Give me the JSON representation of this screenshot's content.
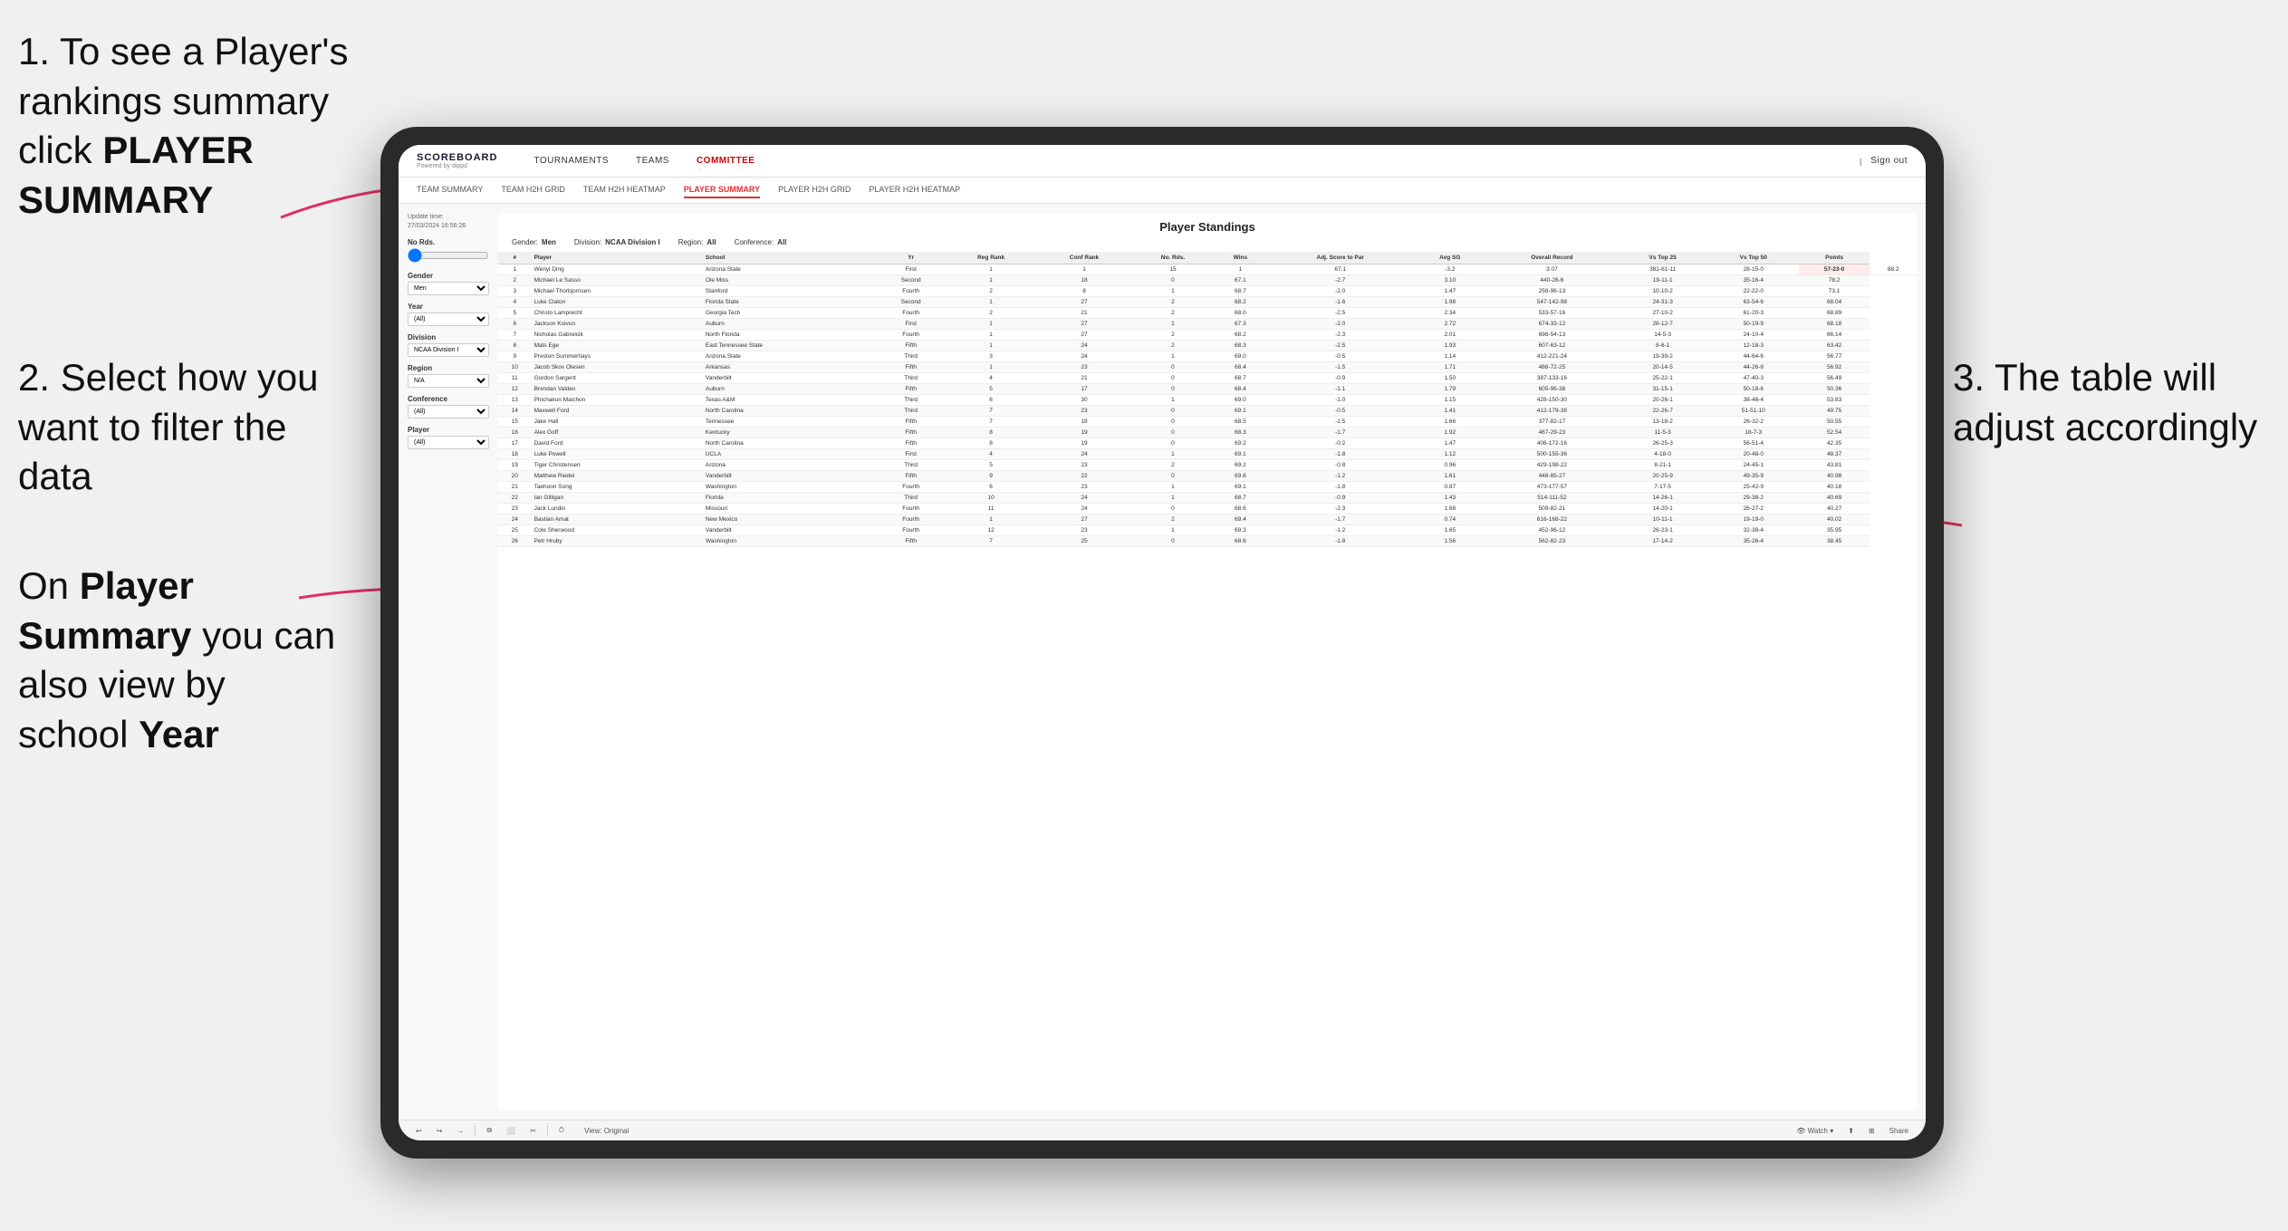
{
  "instructions": {
    "step1": "1. To see a Player's rankings summary click ",
    "step1_bold": "PLAYER SUMMARY",
    "step2_title": "2. Select how you want to filter the data",
    "step3_title": "3. The table will adjust accordingly",
    "step_on": "On ",
    "step_on_bold": "Player Summary",
    "step_on_rest": " you can also view by school ",
    "step_on_year": "Year"
  },
  "nav": {
    "logo": "SCOREBOARD",
    "logo_sub": "Powered by dippd",
    "items": [
      "TOURNAMENTS",
      "TEAMS",
      "COMMITTEE"
    ],
    "right_items": [
      "Sign out"
    ]
  },
  "subnav": {
    "items": [
      "TEAM SUMMARY",
      "TEAM H2H GRID",
      "TEAM H2H HEATMAP",
      "PLAYER SUMMARY",
      "PLAYER H2H GRID",
      "PLAYER H2H HEATMAP"
    ],
    "active": "PLAYER SUMMARY"
  },
  "filters": {
    "update_label": "Update time:",
    "update_time": "27/03/2024 16:56:26",
    "no_rds_label": "No Rds.",
    "gender_label": "Gender",
    "gender_value": "Men",
    "year_label": "Year",
    "year_value": "(All)",
    "division_label": "Division",
    "division_value": "NCAA Division I",
    "region_label": "Region",
    "region_value": "N/A",
    "conference_label": "Conference",
    "conference_value": "(All)",
    "player_label": "Player",
    "player_value": "(All)"
  },
  "table": {
    "title": "Player Standings",
    "gender_label": "Gender:",
    "gender_val": "Men",
    "division_label": "Division:",
    "division_val": "NCAA Division I",
    "region_label": "Region:",
    "region_val": "All",
    "conference_label": "Conference:",
    "conference_val": "All",
    "headers": [
      "#",
      "Player",
      "School",
      "Yr",
      "Reg Rank",
      "Conf Rank",
      "No. Rds.",
      "Wins",
      "Adj. Score to Par",
      "Avg SG",
      "Overall Record",
      "Vs Top 25",
      "Vs Top 50",
      "Points"
    ],
    "rows": [
      [
        "1",
        "Wenyi Ding",
        "Arizona State",
        "First",
        "1",
        "1",
        "15",
        "1",
        "67.1",
        "-3.2",
        "3.07",
        "381-61-11",
        "28-15-0",
        "57-23-0",
        "88.2"
      ],
      [
        "2",
        "Michael Le Sasso",
        "Ole Miss",
        "Second",
        "1",
        "18",
        "0",
        "67.1",
        "-2.7",
        "3.10",
        "440-26-6",
        "19-11-1",
        "35-16-4",
        "78.2"
      ],
      [
        "3",
        "Michael Thorbjornsen",
        "Stanford",
        "Fourth",
        "2",
        "8",
        "1",
        "68.7",
        "-2.0",
        "1.47",
        "258-96-13",
        "10-10-2",
        "22-22-0",
        "73.1"
      ],
      [
        "4",
        "Luke Claton",
        "Florida State",
        "Second",
        "1",
        "27",
        "2",
        "68.2",
        "-1.6",
        "1.98",
        "547-142-98",
        "24-31-3",
        "63-54-6",
        "68.04"
      ],
      [
        "5",
        "Christo Lamprecht",
        "Georgia Tech",
        "Fourth",
        "2",
        "21",
        "2",
        "68.0",
        "-2.5",
        "2.34",
        "533-57-16",
        "27-10-2",
        "61-20-3",
        "68.89"
      ],
      [
        "6",
        "Jackson Koivun",
        "Auburn",
        "First",
        "1",
        "27",
        "1",
        "67.3",
        "-2.0",
        "2.72",
        "674-33-12",
        "28-12-7",
        "50-19-9",
        "68.18"
      ],
      [
        "7",
        "Nicholas Gabrelcik",
        "North Florida",
        "Fourth",
        "1",
        "27",
        "2",
        "68.2",
        "-2.3",
        "2.01",
        "698-54-13",
        "14-5-3",
        "24-10-4",
        "66.14"
      ],
      [
        "8",
        "Mats Ege",
        "East Tennessee State",
        "Fifth",
        "1",
        "24",
        "2",
        "68.3",
        "-2.5",
        "1.93",
        "607-63-12",
        "8-6-1",
        "12-18-3",
        "63.42"
      ],
      [
        "9",
        "Preston Summerhays",
        "Arizona State",
        "Third",
        "3",
        "24",
        "1",
        "69.0",
        "-0.5",
        "1.14",
        "412-221-24",
        "19-39-2",
        "44-64-6",
        "56.77"
      ],
      [
        "10",
        "Jacob Skov Olesen",
        "Arkansas",
        "Fifth",
        "1",
        "23",
        "0",
        "68.4",
        "-1.5",
        "1.71",
        "488-72-25",
        "20-14-5",
        "44-26-8",
        "56.92"
      ],
      [
        "11",
        "Gordon Sargent",
        "Vanderbilt",
        "Third",
        "4",
        "21",
        "0",
        "68.7",
        "-0.9",
        "1.50",
        "387-133-16",
        "25-22-1",
        "47-40-3",
        "56.49"
      ],
      [
        "12",
        "Brendan Valdes",
        "Auburn",
        "Fifth",
        "5",
        "17",
        "0",
        "68.4",
        "-1.1",
        "1.79",
        "605-96-38",
        "31-15-1",
        "50-18-6",
        "50.36"
      ],
      [
        "13",
        "Phichakun Maichon",
        "Texas A&M",
        "Third",
        "6",
        "30",
        "1",
        "69.0",
        "-1.0",
        "1.15",
        "428-150-30",
        "20-26-1",
        "38-46-4",
        "53.83"
      ],
      [
        "14",
        "Maxwell Ford",
        "North Carolina",
        "Third",
        "7",
        "23",
        "0",
        "69.1",
        "-0.5",
        "1.41",
        "412-179-38",
        "22-26-7",
        "51-51-10",
        "49.75"
      ],
      [
        "15",
        "Jake Hall",
        "Tennessee",
        "Fifth",
        "7",
        "18",
        "0",
        "68.5",
        "-1.5",
        "1.66",
        "377-82-17",
        "13-18-2",
        "26-32-2",
        "50.55"
      ],
      [
        "16",
        "Alex Goff",
        "Kentucky",
        "Fifth",
        "8",
        "19",
        "0",
        "68.3",
        "-1.7",
        "1.92",
        "467-29-23",
        "11-5-3",
        "18-7-3",
        "52.54"
      ],
      [
        "17",
        "David Ford",
        "North Carolina",
        "Fifth",
        "8",
        "19",
        "0",
        "69.2",
        "-0.2",
        "1.47",
        "406-172-16",
        "26-25-3",
        "56-51-4",
        "42.35"
      ],
      [
        "18",
        "Luke Powell",
        "UCLA",
        "First",
        "4",
        "24",
        "1",
        "69.1",
        "-1.8",
        "1.12",
        "500-155-36",
        "4-18-0",
        "20-48-0",
        "48.37"
      ],
      [
        "19",
        "Tiger Christensen",
        "Arizona",
        "Third",
        "5",
        "23",
        "2",
        "69.2",
        "-0.8",
        "0.96",
        "429-198-22",
        "8-21-1",
        "24-45-1",
        "43.81"
      ],
      [
        "20",
        "Matthew Riedel",
        "Vanderbilt",
        "Fifth",
        "9",
        "22",
        "0",
        "69.8",
        "-1.2",
        "1.61",
        "448-85-27",
        "20-25-9",
        "49-35-9",
        "40.98"
      ],
      [
        "21",
        "Taehoon Song",
        "Washington",
        "Fourth",
        "6",
        "23",
        "1",
        "69.1",
        "-1.8",
        "0.87",
        "473-177-57",
        "7-17-5",
        "25-42-9",
        "40.18"
      ],
      [
        "22",
        "Ian Gilligan",
        "Florida",
        "Third",
        "10",
        "24",
        "1",
        "68.7",
        "-0.9",
        "1.43",
        "514-111-52",
        "14-26-1",
        "29-38-2",
        "40.69"
      ],
      [
        "23",
        "Jack Lundin",
        "Missouri",
        "Fourth",
        "11",
        "24",
        "0",
        "68.6",
        "-2.3",
        "1.68",
        "509-82-21",
        "14-20-1",
        "26-27-2",
        "40.27"
      ],
      [
        "24",
        "Bastian Amat",
        "New Mexico",
        "Fourth",
        "1",
        "27",
        "2",
        "69.4",
        "-1.7",
        "0.74",
        "616-168-22",
        "10-11-1",
        "19-19-0",
        "40.02"
      ],
      [
        "25",
        "Cole Sherwood",
        "Vanderbilt",
        "Fourth",
        "12",
        "23",
        "1",
        "69.3",
        "-1.2",
        "1.65",
        "452-96-12",
        "26-23-1",
        "32-38-4",
        "35.95"
      ],
      [
        "26",
        "Petr Hruby",
        "Washington",
        "Fifth",
        "7",
        "25",
        "0",
        "68.6",
        "-1.8",
        "1.56",
        "562-82-23",
        "17-14-2",
        "35-26-4",
        "38.45"
      ]
    ]
  },
  "toolbar": {
    "view_label": "View: Original",
    "watch_label": "Watch",
    "share_label": "Share"
  }
}
